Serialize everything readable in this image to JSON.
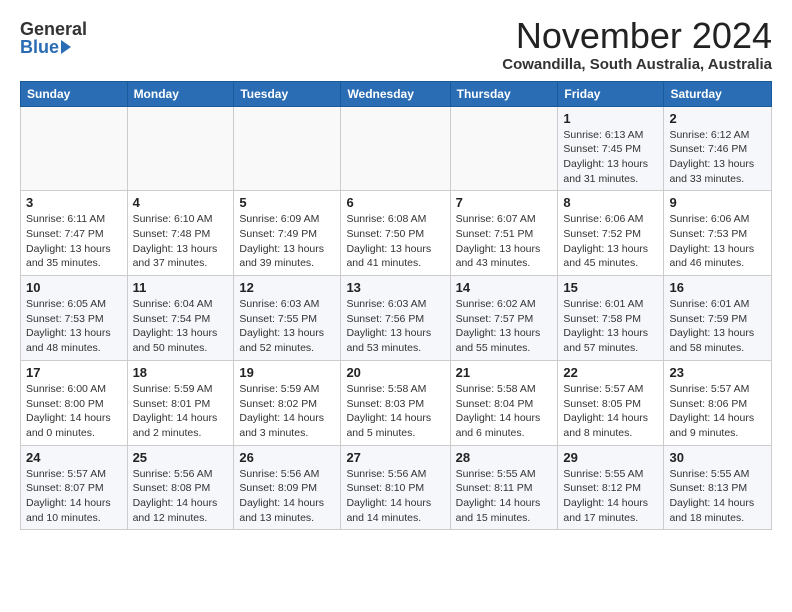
{
  "header": {
    "logo_general": "General",
    "logo_blue": "Blue",
    "month_title": "November 2024",
    "location": "Cowandilla, South Australia, Australia"
  },
  "weekdays": [
    "Sunday",
    "Monday",
    "Tuesday",
    "Wednesday",
    "Thursday",
    "Friday",
    "Saturday"
  ],
  "weeks": [
    [
      {
        "day": "",
        "info": ""
      },
      {
        "day": "",
        "info": ""
      },
      {
        "day": "",
        "info": ""
      },
      {
        "day": "",
        "info": ""
      },
      {
        "day": "",
        "info": ""
      },
      {
        "day": "1",
        "info": "Sunrise: 6:13 AM\nSunset: 7:45 PM\nDaylight: 13 hours\nand 31 minutes."
      },
      {
        "day": "2",
        "info": "Sunrise: 6:12 AM\nSunset: 7:46 PM\nDaylight: 13 hours\nand 33 minutes."
      }
    ],
    [
      {
        "day": "3",
        "info": "Sunrise: 6:11 AM\nSunset: 7:47 PM\nDaylight: 13 hours\nand 35 minutes."
      },
      {
        "day": "4",
        "info": "Sunrise: 6:10 AM\nSunset: 7:48 PM\nDaylight: 13 hours\nand 37 minutes."
      },
      {
        "day": "5",
        "info": "Sunrise: 6:09 AM\nSunset: 7:49 PM\nDaylight: 13 hours\nand 39 minutes."
      },
      {
        "day": "6",
        "info": "Sunrise: 6:08 AM\nSunset: 7:50 PM\nDaylight: 13 hours\nand 41 minutes."
      },
      {
        "day": "7",
        "info": "Sunrise: 6:07 AM\nSunset: 7:51 PM\nDaylight: 13 hours\nand 43 minutes."
      },
      {
        "day": "8",
        "info": "Sunrise: 6:06 AM\nSunset: 7:52 PM\nDaylight: 13 hours\nand 45 minutes."
      },
      {
        "day": "9",
        "info": "Sunrise: 6:06 AM\nSunset: 7:53 PM\nDaylight: 13 hours\nand 46 minutes."
      }
    ],
    [
      {
        "day": "10",
        "info": "Sunrise: 6:05 AM\nSunset: 7:53 PM\nDaylight: 13 hours\nand 48 minutes."
      },
      {
        "day": "11",
        "info": "Sunrise: 6:04 AM\nSunset: 7:54 PM\nDaylight: 13 hours\nand 50 minutes."
      },
      {
        "day": "12",
        "info": "Sunrise: 6:03 AM\nSunset: 7:55 PM\nDaylight: 13 hours\nand 52 minutes."
      },
      {
        "day": "13",
        "info": "Sunrise: 6:03 AM\nSunset: 7:56 PM\nDaylight: 13 hours\nand 53 minutes."
      },
      {
        "day": "14",
        "info": "Sunrise: 6:02 AM\nSunset: 7:57 PM\nDaylight: 13 hours\nand 55 minutes."
      },
      {
        "day": "15",
        "info": "Sunrise: 6:01 AM\nSunset: 7:58 PM\nDaylight: 13 hours\nand 57 minutes."
      },
      {
        "day": "16",
        "info": "Sunrise: 6:01 AM\nSunset: 7:59 PM\nDaylight: 13 hours\nand 58 minutes."
      }
    ],
    [
      {
        "day": "17",
        "info": "Sunrise: 6:00 AM\nSunset: 8:00 PM\nDaylight: 14 hours\nand 0 minutes."
      },
      {
        "day": "18",
        "info": "Sunrise: 5:59 AM\nSunset: 8:01 PM\nDaylight: 14 hours\nand 2 minutes."
      },
      {
        "day": "19",
        "info": "Sunrise: 5:59 AM\nSunset: 8:02 PM\nDaylight: 14 hours\nand 3 minutes."
      },
      {
        "day": "20",
        "info": "Sunrise: 5:58 AM\nSunset: 8:03 PM\nDaylight: 14 hours\nand 5 minutes."
      },
      {
        "day": "21",
        "info": "Sunrise: 5:58 AM\nSunset: 8:04 PM\nDaylight: 14 hours\nand 6 minutes."
      },
      {
        "day": "22",
        "info": "Sunrise: 5:57 AM\nSunset: 8:05 PM\nDaylight: 14 hours\nand 8 minutes."
      },
      {
        "day": "23",
        "info": "Sunrise: 5:57 AM\nSunset: 8:06 PM\nDaylight: 14 hours\nand 9 minutes."
      }
    ],
    [
      {
        "day": "24",
        "info": "Sunrise: 5:57 AM\nSunset: 8:07 PM\nDaylight: 14 hours\nand 10 minutes."
      },
      {
        "day": "25",
        "info": "Sunrise: 5:56 AM\nSunset: 8:08 PM\nDaylight: 14 hours\nand 12 minutes."
      },
      {
        "day": "26",
        "info": "Sunrise: 5:56 AM\nSunset: 8:09 PM\nDaylight: 14 hours\nand 13 minutes."
      },
      {
        "day": "27",
        "info": "Sunrise: 5:56 AM\nSunset: 8:10 PM\nDaylight: 14 hours\nand 14 minutes."
      },
      {
        "day": "28",
        "info": "Sunrise: 5:55 AM\nSunset: 8:11 PM\nDaylight: 14 hours\nand 15 minutes."
      },
      {
        "day": "29",
        "info": "Sunrise: 5:55 AM\nSunset: 8:12 PM\nDaylight: 14 hours\nand 17 minutes."
      },
      {
        "day": "30",
        "info": "Sunrise: 5:55 AM\nSunset: 8:13 PM\nDaylight: 14 hours\nand 18 minutes."
      }
    ]
  ]
}
